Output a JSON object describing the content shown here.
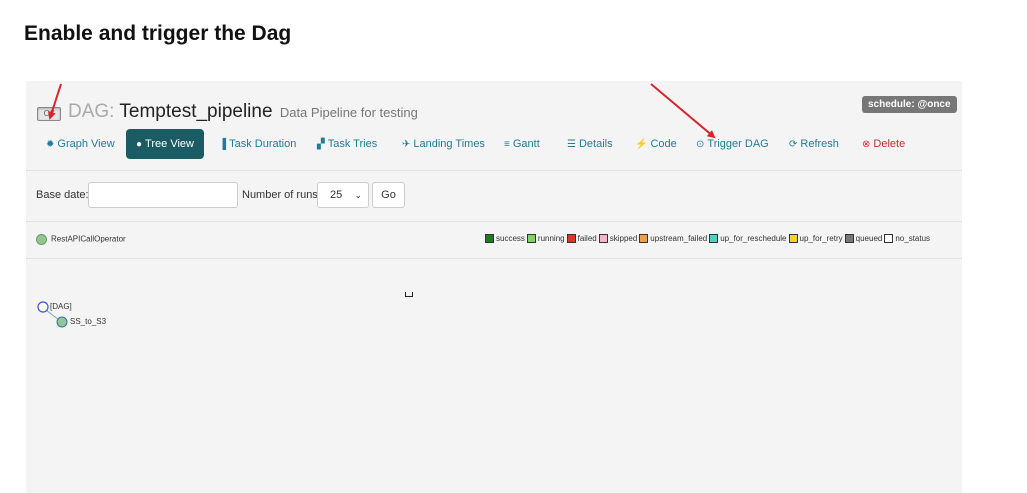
{
  "doc": {
    "title": "Enable and trigger the Dag"
  },
  "dag": {
    "toggle_label": "Off",
    "label_prefix": "DAG:",
    "name": "Temptest_pipeline",
    "description": "Data Pipeline for testing",
    "schedule": "schedule: @once"
  },
  "nav": [
    {
      "label": "Graph View",
      "icon": "graph-icon",
      "glyph": "✹"
    },
    {
      "label": "Tree View",
      "icon": "tree-icon",
      "glyph": "●"
    },
    {
      "label": "Task Duration",
      "icon": "bar-chart-icon",
      "glyph": "▐"
    },
    {
      "label": "Task Tries",
      "icon": "copy-icon",
      "glyph": "▞"
    },
    {
      "label": "Landing Times",
      "icon": "plane-icon",
      "glyph": "✈"
    },
    {
      "label": "Gantt",
      "icon": "gantt-icon",
      "glyph": "≡"
    },
    {
      "label": "Details",
      "icon": "list-icon",
      "glyph": "☰"
    },
    {
      "label": "Code",
      "icon": "bolt-icon",
      "glyph": "⚡"
    },
    {
      "label": "Trigger DAG",
      "icon": "play-circle-icon",
      "glyph": "⊙"
    },
    {
      "label": "Refresh",
      "icon": "refresh-icon",
      "glyph": "⟳"
    },
    {
      "label": "Delete",
      "icon": "delete-circle-icon",
      "glyph": "⊗"
    }
  ],
  "form": {
    "base_date_label": "Base date:",
    "base_date_value": "",
    "runs_label": "Number of runs:",
    "runs_value": "25",
    "go_label": "Go"
  },
  "operator": {
    "label": "RestAPICallOperator"
  },
  "legend": [
    {
      "label": "success",
      "color": "#1e7c1e"
    },
    {
      "label": "running",
      "color": "#7cd46b"
    },
    {
      "label": "failed",
      "color": "#e0332b"
    },
    {
      "label": "skipped",
      "color": "#f7b6c8"
    },
    {
      "label": "upstream_failed",
      "color": "#f0a04b"
    },
    {
      "label": "up_for_reschedule",
      "color": "#4fd1c5"
    },
    {
      "label": "up_for_retry",
      "color": "#f2d230"
    },
    {
      "label": "queued",
      "color": "#777777"
    },
    {
      "label": "no_status",
      "color": "#ffffff"
    }
  ],
  "tree": {
    "root_label": "[DAG]",
    "task_label": "SS_to_S3"
  },
  "colors": {
    "annotation_arrow": "#d9232e",
    "active_tab": "#1b5b63",
    "link": "#1e7d9a"
  }
}
